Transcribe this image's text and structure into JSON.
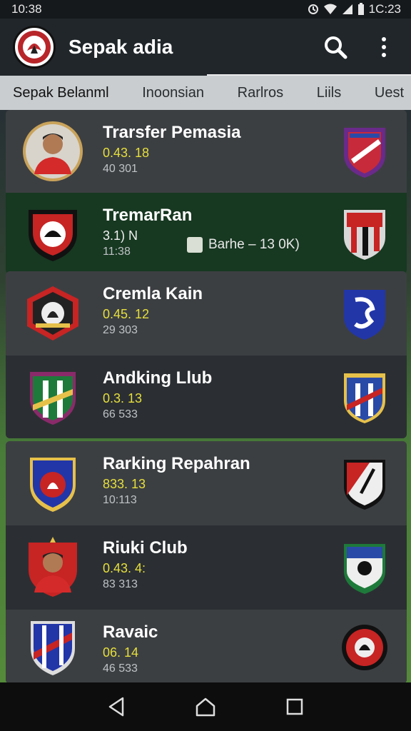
{
  "status_bar": {
    "time": "10:38",
    "right_text": "1C:23"
  },
  "app_bar": {
    "title": "Sepak adia"
  },
  "tabs": [
    "Sepak Belanml",
    "Inoonsian",
    "Rarlros",
    "Liils",
    "Uest"
  ],
  "rows": [
    {
      "title": "Trarsfer Pemasia",
      "value1": "0.43. 18",
      "value2": "40 301",
      "value1_color": "#e6df3c",
      "logo": "player-photo-icon",
      "crest": "striped-shield-crest-icon"
    },
    {
      "title": "TremarRan",
      "value1": "3.1) N",
      "value2": "11:38",
      "value1_color": "#f0f0f0",
      "badge": "Barhe – 13 0K)",
      "logo": "black-red-shield-icon",
      "crest": "red-white-striped-crest-icon"
    },
    {
      "title": "Cremla Kain",
      "value1": "0.45. 12",
      "value2": "29 303",
      "value1_color": "#e6df3c",
      "logo": "red-hexagon-crest-icon",
      "crest": "blue-shield-crest-icon"
    },
    {
      "title": "Andking Llub",
      "value1": "0.3. 13",
      "value2": "66 533",
      "value1_color": "#e6df3c",
      "logo": "green-striped-shield-icon",
      "crest": "blue-striped-shield-icon"
    },
    {
      "title": "Rarking Repahran",
      "value1": "833. 13",
      "value2": "10:113",
      "value1_color": "#e6df3c",
      "logo": "blue-red-shield-icon",
      "crest": "red-black-shield-icon"
    },
    {
      "title": "Riuki Club",
      "value1": "0.43. 4:",
      "value2": "83 313",
      "value1_color": "#e6df3c",
      "logo": "player-photo-icon",
      "crest": "green-white-shield-icon"
    },
    {
      "title": "Ravaic",
      "value1": "06. 14",
      "value2": "46 533",
      "value1_color": "#e6df3c",
      "logo": "blue-diagonal-shield-icon",
      "crest": "red-black-round-crest-icon"
    }
  ],
  "nav": {
    "back": "back-icon",
    "home": "home-icon",
    "recents": "recents-icon"
  }
}
